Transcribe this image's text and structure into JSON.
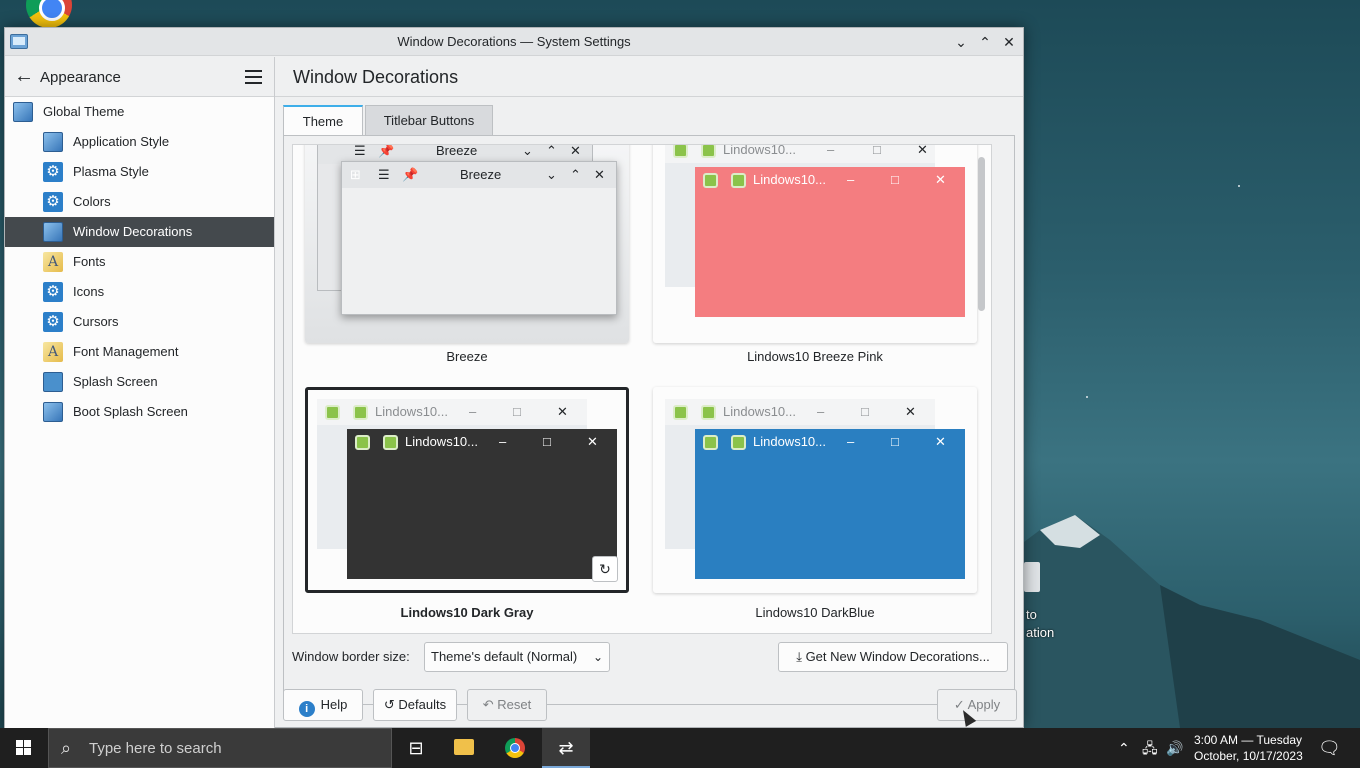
{
  "window": {
    "title": "Window Decorations — System Settings",
    "controls": {
      "minimize": "⌄",
      "maximize": "⌃",
      "close": "✕"
    }
  },
  "sidebar": {
    "title": "Appearance",
    "items": [
      {
        "label": "Global Theme",
        "icon": "monitor-icon"
      },
      {
        "label": "Application Style",
        "icon": "monitor-icon"
      },
      {
        "label": "Plasma Style",
        "icon": "gear-icon"
      },
      {
        "label": "Colors",
        "icon": "gear-icon"
      },
      {
        "label": "Window Decorations",
        "icon": "monitor-icon"
      },
      {
        "label": "Fonts",
        "icon": "font-icon"
      },
      {
        "label": "Icons",
        "icon": "gear-icon"
      },
      {
        "label": "Cursors",
        "icon": "gear-icon"
      },
      {
        "label": "Font Management",
        "icon": "font-icon"
      },
      {
        "label": "Splash Screen",
        "icon": "splash-icon"
      },
      {
        "label": "Boot Splash Screen",
        "icon": "monitor-icon"
      }
    ]
  },
  "main": {
    "title": "Window Decorations",
    "tabs": [
      {
        "label": "Theme"
      },
      {
        "label": "Titlebar Buttons"
      }
    ],
    "themes": [
      {
        "name": "Breeze",
        "preview_title": "Breeze",
        "color": "#eff0f1"
      },
      {
        "name": "Lindows10 Breeze Pink",
        "preview_title": "Lindows10...",
        "color": "#f47d80"
      },
      {
        "name": "Lindows10 Dark Gray",
        "preview_title": "Lindows10...",
        "color": "#333333"
      },
      {
        "name": "Lindows10 DarkBlue",
        "preview_title": "Lindows10...",
        "color": "#2a7fc1"
      }
    ],
    "border_size_label": "Window border size:",
    "border_size_value": "Theme's default (Normal)",
    "get_new_label": "Get New Window Decorations..."
  },
  "footer": {
    "help": "Help",
    "defaults": "Defaults",
    "reset": "Reset",
    "apply": "Apply"
  },
  "desktop": {
    "icon_label": "to\nation"
  },
  "taskbar": {
    "search_placeholder": "Type here to search",
    "clock_line1": "3:00 AM — Tuesday",
    "clock_line2": "October, 10/17/2023"
  },
  "colors": {
    "accent": "#3daee9",
    "selection": "#44494d",
    "taskbar": "#1f1f1f"
  }
}
